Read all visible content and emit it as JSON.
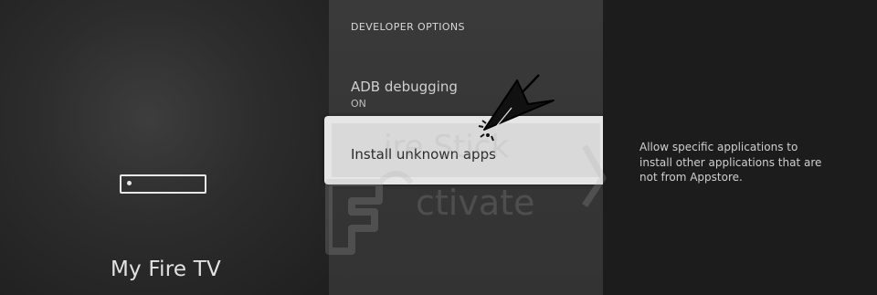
{
  "sidebar": {
    "title": "My Fire TV",
    "icon": "fire-tv-stick-icon"
  },
  "menu": {
    "section_title": "DEVELOPER OPTIONS",
    "items": [
      {
        "label": "ADB debugging",
        "value": "ON"
      },
      {
        "label": "Install unknown apps",
        "value": ""
      }
    ],
    "selected_index": 1
  },
  "detail": {
    "description": "Allow specific applications to install other applications that are not from Appstore."
  },
  "overlay": {
    "pointer_icon": "arrow-pointer-icon",
    "watermark_text": "Fire Stick Activate"
  },
  "colors": {
    "selected_bg": "#e6e6e6",
    "text_light": "#e2e2e2",
    "text_dark": "#2a2a2a"
  }
}
